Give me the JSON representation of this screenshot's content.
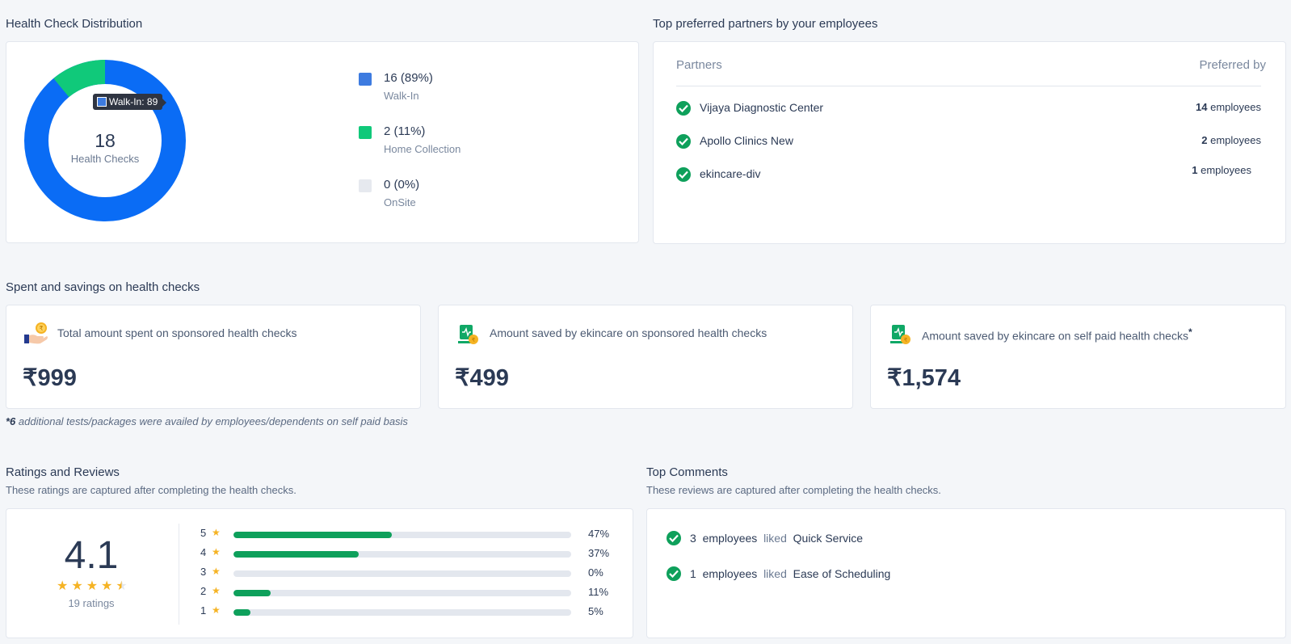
{
  "health_check_distribution": {
    "title": "Health Check Distribution",
    "total": "18",
    "total_label": "Health Checks",
    "tooltip": "Walk-In: 89",
    "items": [
      {
        "value": "16 (89%)",
        "label": "Walk-In",
        "percent": 89,
        "color": "#3d7be0"
      },
      {
        "value": "2 (11%)",
        "label": "Home Collection",
        "percent": 11,
        "color": "#10c97a"
      },
      {
        "value": "0 (0%)",
        "label": "OnSite",
        "percent": 0,
        "color": "#e6e9ef"
      }
    ],
    "donut_colors": {
      "walk_in": "#0a6cf5",
      "home_collection": "#10c97a"
    }
  },
  "partners": {
    "title": "Top preferred partners by your employees",
    "col_partners": "Partners",
    "col_preferred": "Preferred by",
    "rows": [
      {
        "name": "Vijaya Diagnostic Center",
        "count": "14",
        "unit": "employees"
      },
      {
        "name": "Apollo Clinics New",
        "count": "2",
        "unit": "employees"
      },
      {
        "name": "ekincare-div",
        "count": "1",
        "unit": "employees"
      }
    ]
  },
  "spent": {
    "title": "Spent and savings on health checks",
    "cards": [
      {
        "label": "Total amount spent on sponsored health checks",
        "amount": "₹999",
        "icon": "hand-coin-icon"
      },
      {
        "label": "Amount saved by ekincare on sponsored health checks",
        "amount": "₹499",
        "icon": "savings-icon"
      },
      {
        "label": "Amount saved by ekincare on self paid health checks",
        "asterisk": "*",
        "amount": "₹1,574",
        "icon": "savings-icon"
      }
    ],
    "footnote_prefix": "*6",
    "footnote_text": " additional tests/packages were availed by employees/dependents on self paid basis"
  },
  "ratings": {
    "title": "Ratings and Reviews",
    "subtitle": "These ratings are captured after completing the health checks.",
    "average": "4.1",
    "average_value": 4.1,
    "count_label": "19 ratings",
    "bars": [
      {
        "stars": "5",
        "percent": 47,
        "pct_label": "47%"
      },
      {
        "stars": "4",
        "percent": 37,
        "pct_label": "37%"
      },
      {
        "stars": "3",
        "percent": 0,
        "pct_label": "0%"
      },
      {
        "stars": "2",
        "percent": 11,
        "pct_label": "11%"
      },
      {
        "stars": "1",
        "percent": 5,
        "pct_label": "5%"
      }
    ]
  },
  "comments": {
    "title": "Top Comments",
    "subtitle": "These reviews are captured after completing the health checks.",
    "rows": [
      {
        "count": "3",
        "unit": "employees",
        "verb": "liked",
        "topic": "Quick Service"
      },
      {
        "count": "1",
        "unit": "employees",
        "verb": "liked",
        "topic": "Ease of Scheduling"
      }
    ]
  }
}
